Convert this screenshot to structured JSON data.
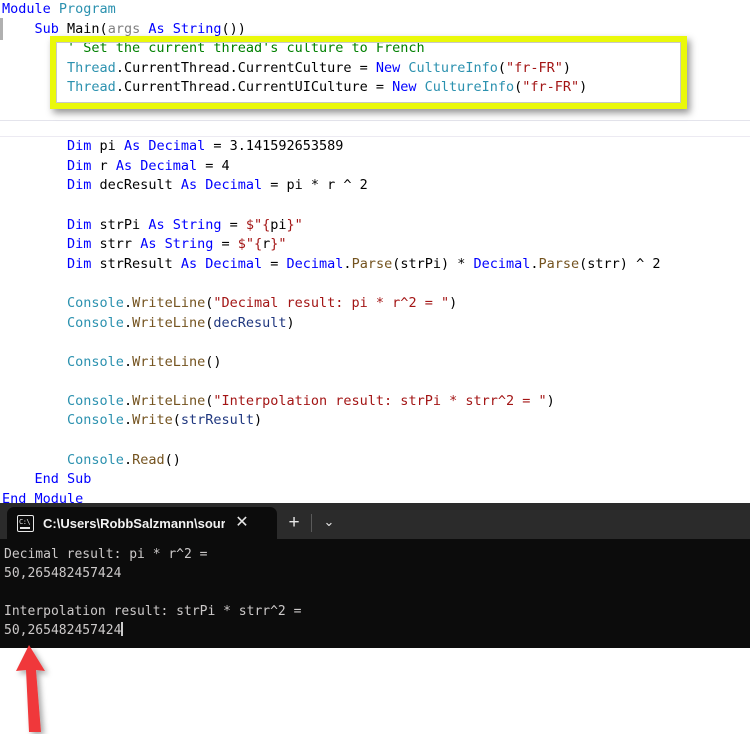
{
  "editor": {
    "language": "Visual Basic .NET",
    "code_lines": [
      [
        {
          "t": "Module ",
          "c": "kw"
        },
        {
          "t": "Program",
          "c": "typ"
        }
      ],
      [
        {
          "t": "    ",
          "c": "op"
        },
        {
          "t": "Sub ",
          "c": "kw"
        },
        {
          "t": "Main",
          "c": "num"
        },
        {
          "t": "(",
          "c": "op"
        },
        {
          "t": "args",
          "c": "par"
        },
        {
          "t": " As ",
          "c": "kw"
        },
        {
          "t": "String",
          "c": "kw"
        },
        {
          "t": "())",
          "c": "op"
        }
      ],
      [
        {
          "t": "        ",
          "c": "op"
        },
        {
          "t": "' Set the current thread's culture to French",
          "c": "cmt"
        }
      ],
      [
        {
          "t": "        ",
          "c": "op"
        },
        {
          "t": "Thread",
          "c": "typ"
        },
        {
          "t": ".CurrentThread.CurrentCulture = ",
          "c": "op"
        },
        {
          "t": "New ",
          "c": "kw"
        },
        {
          "t": "CultureInfo",
          "c": "typ"
        },
        {
          "t": "(",
          "c": "op"
        },
        {
          "t": "\"fr-FR\"",
          "c": "str"
        },
        {
          "t": ")",
          "c": "op"
        }
      ],
      [
        {
          "t": "        ",
          "c": "op"
        },
        {
          "t": "Thread",
          "c": "typ"
        },
        {
          "t": ".CurrentThread.CurrentUICulture = ",
          "c": "op"
        },
        {
          "t": "New ",
          "c": "kw"
        },
        {
          "t": "CultureInfo",
          "c": "typ"
        },
        {
          "t": "(",
          "c": "op"
        },
        {
          "t": "\"fr-FR\"",
          "c": "str"
        },
        {
          "t": ")",
          "c": "op"
        }
      ],
      [],
      [],
      [
        {
          "t": "        ",
          "c": "op"
        },
        {
          "t": "Dim ",
          "c": "kw"
        },
        {
          "t": "pi",
          "c": "num"
        },
        {
          "t": " As ",
          "c": "kw"
        },
        {
          "t": "Decimal",
          "c": "kw"
        },
        {
          "t": " = 3.141592653589",
          "c": "num"
        }
      ],
      [
        {
          "t": "        ",
          "c": "op"
        },
        {
          "t": "Dim ",
          "c": "kw"
        },
        {
          "t": "r",
          "c": "num"
        },
        {
          "t": " As ",
          "c": "kw"
        },
        {
          "t": "Decimal",
          "c": "kw"
        },
        {
          "t": " = 4",
          "c": "num"
        }
      ],
      [
        {
          "t": "        ",
          "c": "op"
        },
        {
          "t": "Dim ",
          "c": "kw"
        },
        {
          "t": "decResult",
          "c": "num"
        },
        {
          "t": " As ",
          "c": "kw"
        },
        {
          "t": "Decimal",
          "c": "kw"
        },
        {
          "t": " = pi * r ^ 2",
          "c": "num"
        }
      ],
      [],
      [
        {
          "t": "        ",
          "c": "op"
        },
        {
          "t": "Dim ",
          "c": "kw"
        },
        {
          "t": "strPi",
          "c": "num"
        },
        {
          "t": " As ",
          "c": "kw"
        },
        {
          "t": "String",
          "c": "kw"
        },
        {
          "t": " = ",
          "c": "op"
        },
        {
          "t": "$\"{",
          "c": "str"
        },
        {
          "t": "pi",
          "c": "num"
        },
        {
          "t": "}\"",
          "c": "str"
        }
      ],
      [
        {
          "t": "        ",
          "c": "op"
        },
        {
          "t": "Dim ",
          "c": "kw"
        },
        {
          "t": "strr",
          "c": "num"
        },
        {
          "t": " As ",
          "c": "kw"
        },
        {
          "t": "String",
          "c": "kw"
        },
        {
          "t": " = ",
          "c": "op"
        },
        {
          "t": "$\"{",
          "c": "str"
        },
        {
          "t": "r",
          "c": "num"
        },
        {
          "t": "}\"",
          "c": "str"
        }
      ],
      [
        {
          "t": "        ",
          "c": "op"
        },
        {
          "t": "Dim ",
          "c": "kw"
        },
        {
          "t": "strResult",
          "c": "num"
        },
        {
          "t": " As ",
          "c": "kw"
        },
        {
          "t": "Decimal",
          "c": "kw"
        },
        {
          "t": " = ",
          "c": "op"
        },
        {
          "t": "Decimal",
          "c": "kw"
        },
        {
          "t": ".",
          "c": "op"
        },
        {
          "t": "Parse",
          "c": "fn"
        },
        {
          "t": "(strPi) * ",
          "c": "op"
        },
        {
          "t": "Decimal",
          "c": "kw"
        },
        {
          "t": ".",
          "c": "op"
        },
        {
          "t": "Parse",
          "c": "fn"
        },
        {
          "t": "(strr) ^ 2",
          "c": "op"
        }
      ],
      [],
      [
        {
          "t": "        ",
          "c": "op"
        },
        {
          "t": "Console",
          "c": "typ"
        },
        {
          "t": ".",
          "c": "op"
        },
        {
          "t": "WriteLine",
          "c": "fn"
        },
        {
          "t": "(",
          "c": "op"
        },
        {
          "t": "\"Decimal result: pi * r^2 = \"",
          "c": "str"
        },
        {
          "t": ")",
          "c": "op"
        }
      ],
      [
        {
          "t": "        ",
          "c": "op"
        },
        {
          "t": "Console",
          "c": "typ"
        },
        {
          "t": ".",
          "c": "op"
        },
        {
          "t": "WriteLine",
          "c": "fn"
        },
        {
          "t": "(",
          "c": "op"
        },
        {
          "t": "decResult",
          "c": "var"
        },
        {
          "t": ")",
          "c": "op"
        }
      ],
      [],
      [
        {
          "t": "        ",
          "c": "op"
        },
        {
          "t": "Console",
          "c": "typ"
        },
        {
          "t": ".",
          "c": "op"
        },
        {
          "t": "WriteLine",
          "c": "fn"
        },
        {
          "t": "()",
          "c": "op"
        }
      ],
      [],
      [
        {
          "t": "        ",
          "c": "op"
        },
        {
          "t": "Console",
          "c": "typ"
        },
        {
          "t": ".",
          "c": "op"
        },
        {
          "t": "WriteLine",
          "c": "fn"
        },
        {
          "t": "(",
          "c": "op"
        },
        {
          "t": "\"Interpolation result: strPi * strr^2 = \"",
          "c": "str"
        },
        {
          "t": ")",
          "c": "op"
        }
      ],
      [
        {
          "t": "        ",
          "c": "op"
        },
        {
          "t": "Console",
          "c": "typ"
        },
        {
          "t": ".",
          "c": "op"
        },
        {
          "t": "Write",
          "c": "fn"
        },
        {
          "t": "(",
          "c": "op"
        },
        {
          "t": "strResult",
          "c": "var"
        },
        {
          "t": ")",
          "c": "op"
        }
      ],
      [],
      [
        {
          "t": "        ",
          "c": "op"
        },
        {
          "t": "Console",
          "c": "typ"
        },
        {
          "t": ".",
          "c": "op"
        },
        {
          "t": "Read",
          "c": "fn"
        },
        {
          "t": "()",
          "c": "op"
        }
      ],
      [
        {
          "t": "    ",
          "c": "op"
        },
        {
          "t": "End Sub",
          "c": "kw"
        }
      ],
      [
        {
          "t": "End Module",
          "c": "kw"
        }
      ]
    ],
    "highlight_color": "#eaf90a"
  },
  "terminal": {
    "tab": {
      "icon": "cmd-prompt-icon",
      "title": "C:\\Users\\RobbSalzmann\\sour",
      "close_label": "✕"
    },
    "new_tab_label": "+",
    "dropdown_label": "⌄",
    "output_lines": [
      "Decimal result: pi * r^2 =",
      "50,265482457424",
      "",
      "Interpolation result: strPi * strr^2 =",
      "50,265482457424"
    ],
    "background_color": "#0c0c0c",
    "text_color": "#ccc9c9"
  },
  "annotation": {
    "arrow_color": "#f0393b",
    "points_at": "decimal-comma-separator"
  }
}
